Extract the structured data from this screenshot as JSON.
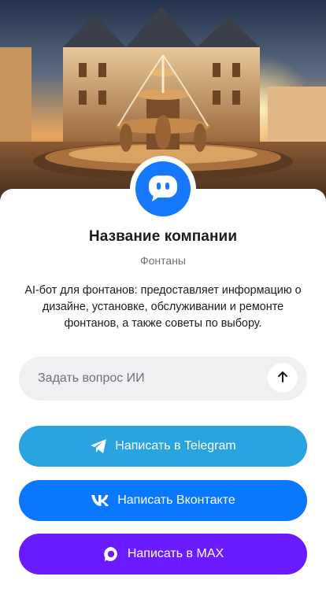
{
  "hero": {
    "image": "fountain-palace-photo"
  },
  "profile": {
    "avatar_icon": "chat-bubble-icon",
    "company_name": "Название компании",
    "category": "Фонтаны",
    "description": "AI-бот для фонтанов: предоставляет информацию о дизайне, установке, обслуживании и ремонте фонтанов, а также советы по выбору."
  },
  "ask": {
    "placeholder": "Задать вопрос ИИ",
    "value": "",
    "send_icon": "arrow-up-icon"
  },
  "buttons": {
    "telegram": {
      "label": "Написать в Telegram",
      "icon": "telegram-icon",
      "color": "#2aa4e0"
    },
    "vk": {
      "label": "Написать Вконтакте",
      "icon": "vk-icon",
      "color": "#0a77ff"
    },
    "max": {
      "label": "Написать в MAX",
      "icon": "max-icon",
      "color": "#6a1bff"
    }
  },
  "colors": {
    "accent": "#1677ff",
    "input_bg": "#f0f0f2"
  }
}
